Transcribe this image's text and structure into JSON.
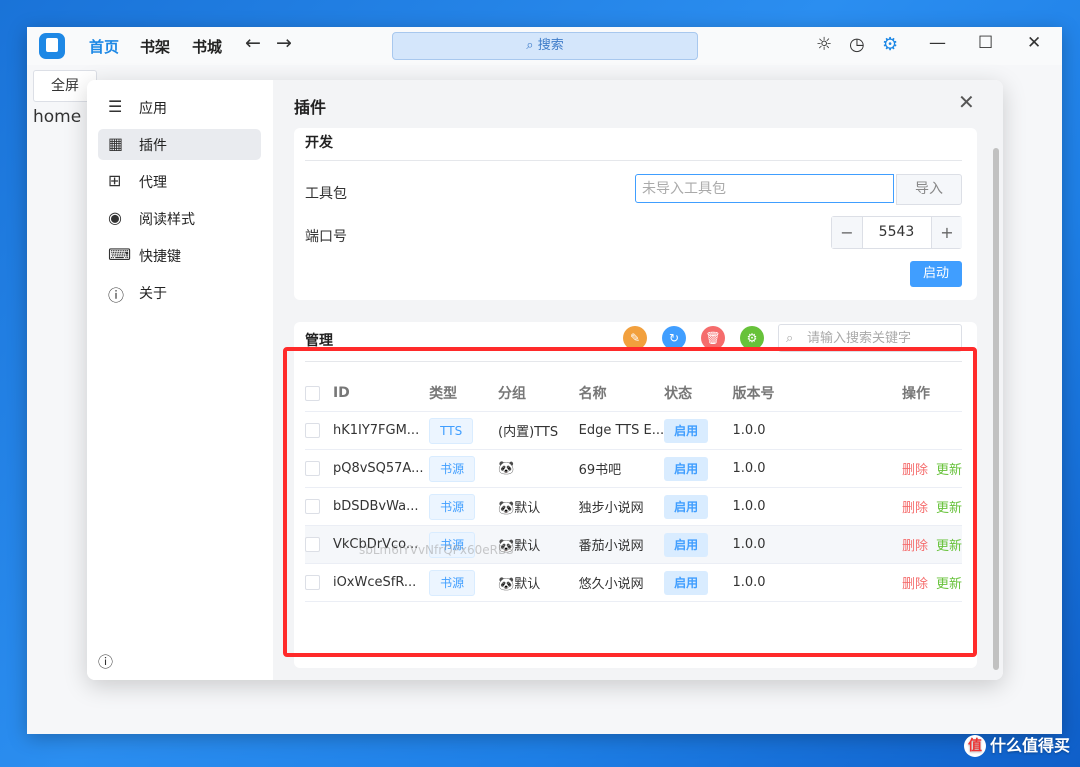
{
  "titlebar": {
    "nav": [
      "首页",
      "书架",
      "书城"
    ],
    "back_icon": "arrow-left-icon",
    "forward_icon": "arrow-right-icon",
    "search_placeholder": "搜索",
    "right_icons": [
      "sun-icon",
      "history-icon",
      "settings-gear-icon"
    ],
    "window_controls": [
      "minimize-icon",
      "maximize-icon",
      "close-icon"
    ]
  },
  "page": {
    "fullscreen_label": "全屏",
    "home_label": "home"
  },
  "sidebar": {
    "items": [
      {
        "label": "应用",
        "icon": "sliders-icon"
      },
      {
        "label": "插件",
        "icon": "grid-icon"
      },
      {
        "label": "代理",
        "icon": "network-icon"
      },
      {
        "label": "阅读样式",
        "icon": "palette-icon"
      },
      {
        "label": "快捷键",
        "icon": "keyboard-icon"
      },
      {
        "label": "关于",
        "icon": "info-icon"
      }
    ],
    "active_index": 1
  },
  "plugins": {
    "title": "插件",
    "dev": {
      "heading": "开发",
      "toolkit_label": "工具包",
      "toolkit_placeholder": "未导入工具包",
      "import_label": "导入",
      "port_label": "端口号",
      "port_value": "5543",
      "start_label": "启动"
    },
    "manage": {
      "heading": "管理",
      "action_icons": [
        "import-icon",
        "refresh-icon",
        "delete-icon",
        "settings-icon"
      ],
      "search_placeholder": "请输入搜索关键字",
      "columns": [
        "ID",
        "类型",
        "分组",
        "名称",
        "状态",
        "版本号",
        "操作"
      ],
      "rows": [
        {
          "id": "hK1IY7FGM...",
          "type": "TTS",
          "group": "(内置)TTS",
          "name": "Edge TTS E...",
          "status": "启用",
          "version": "1.0.0",
          "actions": []
        },
        {
          "id": "pQ8vSQ57A...",
          "type": "书源",
          "group": "",
          "name": "69书吧",
          "status": "启用",
          "version": "1.0.0",
          "actions": [
            "删除",
            "更新"
          ]
        },
        {
          "id": "bDSDBvWa...",
          "type": "书源",
          "group": "默认",
          "name": "独步小说网",
          "status": "启用",
          "version": "1.0.0",
          "actions": [
            "删除",
            "更新"
          ]
        },
        {
          "id": "VkCbDrVco...",
          "type": "书源",
          "group": "默认",
          "name": "番茄小说网",
          "status": "启用",
          "version": "1.0.0",
          "actions": [
            "删除",
            "更新"
          ]
        },
        {
          "id": "iOxWceSfR...",
          "type": "书源",
          "group": "默认",
          "name": "悠久小说网",
          "status": "启用",
          "version": "1.0.0",
          "actions": [
            "删除",
            "更新"
          ]
        }
      ],
      "faint_overlay": "sbLm6IYVvNfrQPx60eRBS"
    }
  },
  "watermark": "什么值得买",
  "colors": {
    "primary": "#409eff",
    "highlight_box": "#ff2a2a",
    "delete": "#f56c6c",
    "update": "#67c23a"
  }
}
